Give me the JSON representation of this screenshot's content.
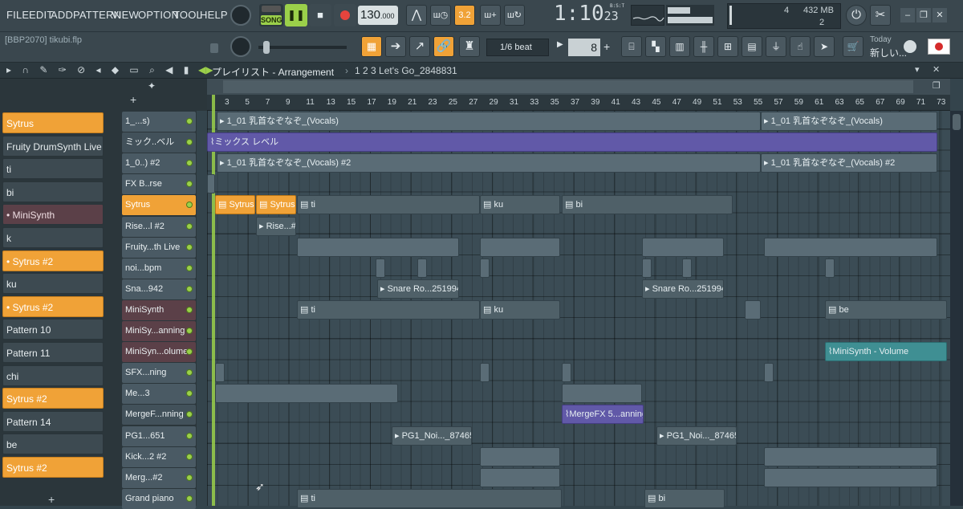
{
  "menu": [
    "FILE",
    "EDIT",
    "ADD",
    "PATTERN",
    "VIEW",
    "OPTION",
    "TOOL",
    "HELP"
  ],
  "transport": {
    "mode": "SONG",
    "tempo": "130",
    "tempo_dec": ".000",
    "time": "1:10",
    "time_sub": "23",
    "time_unit": "B:S:T"
  },
  "monitor": {
    "cpu": "4",
    "ram": "432 MB",
    "poly": "2"
  },
  "project": {
    "file": "[BBP2070] tikubi.flp",
    "snap": "1/6 beat",
    "step": "8"
  },
  "news": {
    "label": "Today",
    "text": "新しい..."
  },
  "playlist": {
    "title": "プレイリスト - Arrangement",
    "crumb": "1 2 3 Let's Go_2848831"
  },
  "ruler": [
    "3",
    "5",
    "7",
    "9",
    "11",
    "13",
    "15",
    "17",
    "19",
    "21",
    "23",
    "25",
    "27",
    "29",
    "31",
    "33",
    "35",
    "37",
    "39",
    "41",
    "43",
    "45",
    "47",
    "49",
    "51",
    "53",
    "55",
    "57",
    "59",
    "61",
    "63",
    "65",
    "67",
    "69",
    "71",
    "73"
  ],
  "picker": [
    {
      "label": "Sytrus",
      "style": "orange"
    },
    {
      "label": "Fruity DrumSynth Live",
      "style": "plain"
    },
    {
      "label": "ti",
      "style": "plain"
    },
    {
      "label": "bi",
      "style": "plain"
    },
    {
      "label": "• MiniSynth",
      "style": "maroon"
    },
    {
      "label": "k",
      "style": "plain"
    },
    {
      "label": "• Sytrus #2",
      "style": "orange"
    },
    {
      "label": "ku",
      "style": "plain"
    },
    {
      "label": "• Sytrus #2",
      "style": "orange"
    },
    {
      "label": "Pattern 10",
      "style": "plain"
    },
    {
      "label": "Pattern 11",
      "style": "plain"
    },
    {
      "label": "chi",
      "style": "plain"
    },
    {
      "label": "Sytrus #2",
      "style": "orange"
    },
    {
      "label": "Pattern 14",
      "style": "plain"
    },
    {
      "label": "be",
      "style": "plain"
    },
    {
      "label": "Sytrus #2",
      "style": "orange"
    }
  ],
  "tracks": [
    {
      "label": "1_...s)",
      "style": "plain"
    },
    {
      "label": "ミック..ベル",
      "style": "sub"
    },
    {
      "label": "1_0..) #2",
      "style": "plain"
    },
    {
      "label": "FX B..rse",
      "style": "plain"
    },
    {
      "label": "Sytrus",
      "style": "orange"
    },
    {
      "label": "Rise...l #2",
      "style": "plain"
    },
    {
      "label": "Fruity...th Live",
      "style": "plain"
    },
    {
      "label": "noi...bpm",
      "style": "plain"
    },
    {
      "label": "Sna...942",
      "style": "plain"
    },
    {
      "label": "MiniSynth",
      "style": "maroon"
    },
    {
      "label": "MiniSy...anning",
      "style": "maroon"
    },
    {
      "label": "MiniSyn...olume",
      "style": "maroon"
    },
    {
      "label": "SFX...ning",
      "style": "plain"
    },
    {
      "label": "Me...3",
      "style": "plain"
    },
    {
      "label": "MergeF...nning",
      "style": "sub"
    },
    {
      "label": "PG1...651",
      "style": "plain"
    },
    {
      "label": "Kick...2 #2",
      "style": "plain"
    },
    {
      "label": "Merg...#2",
      "style": "plain"
    },
    {
      "label": "Grand piano",
      "style": "plain"
    }
  ],
  "clips": {
    "vocals": "1_01 乳首なぞなぞ_(Vocals)",
    "vocals2": "1_01 乳首なぞなぞ_(Vocals) #2",
    "mix": "ミックス レベル",
    "sytrus": "Sytrus",
    "ti": "ti",
    "ku": "ku",
    "bi": "bi",
    "be": "be",
    "rise": "Rise...#2",
    "snare": "Snare Ro...2519942",
    "mini_vol": "MiniSynth - Volume",
    "merge": "MergeFX 5...anning",
    "pg1": "PG1_Noi..._874651"
  }
}
